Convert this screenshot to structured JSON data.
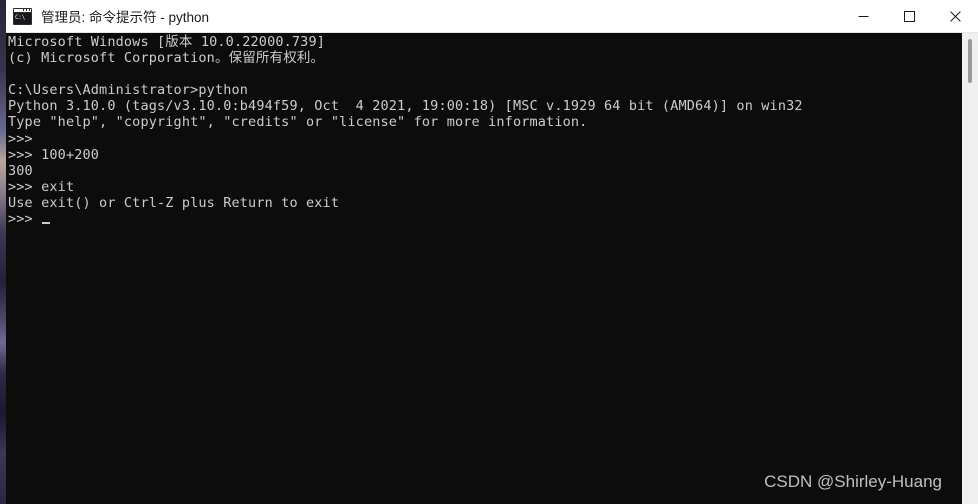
{
  "window": {
    "title": "管理员: 命令提示符 - python",
    "icon_label": "C:\\",
    "minimize_label": "最小化",
    "maximize_label": "最大化",
    "close_label": "关闭"
  },
  "terminal": {
    "background_color": "#0c0c0c",
    "text_color": "#cccccc",
    "lines": [
      "Microsoft Windows [版本 10.0.22000.739]",
      "(c) Microsoft Corporation。保留所有权利。",
      "",
      "C:\\Users\\Administrator>python",
      "Python 3.10.0 (tags/v3.10.0:b494f59, Oct  4 2021, 19:00:18) [MSC v.1929 64 bit (AMD64)] on win32",
      "Type \"help\", \"copyright\", \"credits\" or \"license\" for more information.",
      ">>>",
      ">>> 100+200",
      "300",
      ">>> exit",
      "Use exit() or Ctrl-Z plus Return to exit",
      ">>> "
    ],
    "prompt": ">>> ",
    "cursor_visible": true
  },
  "scrollbar": {
    "track_color": "#f0f0f0",
    "thumb_color": "#9a9a9a"
  },
  "watermark": {
    "text": "CSDN @Shirley-Huang"
  }
}
